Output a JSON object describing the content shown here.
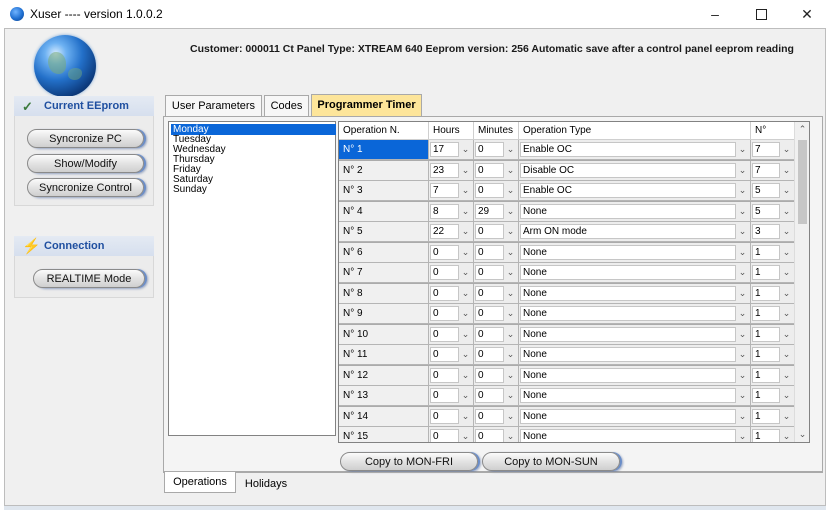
{
  "window": {
    "title": "Xuser ---- version 1.0.0.2"
  },
  "header": {
    "info": "Customer: 000011 Ct Panel Type: XTREAM 640 Eeprom version: 256  Automatic save after a control panel eeprom reading"
  },
  "sidebar": {
    "eeprom_title": "Current EEprom",
    "buttons": [
      "Syncronize PC",
      "Show/Modify",
      "Syncronize Control"
    ],
    "connection_title": "Connection",
    "realtime_label": "REALTIME Mode"
  },
  "tabs": [
    "User Parameters",
    "Codes",
    "Programmer Timer"
  ],
  "days": [
    "Monday",
    "Tuesday",
    "Wednesday",
    "Thursday",
    "Friday",
    "Saturday",
    "Sunday"
  ],
  "grid": {
    "headers": [
      "Operation N.",
      "Hours",
      "Minutes",
      "Operation Type",
      "N°"
    ],
    "rows": [
      {
        "op": "N° 1",
        "hours": "17",
        "minutes": "0",
        "type": "Enable OC",
        "n": "7"
      },
      {
        "op": "N° 2",
        "hours": "23",
        "minutes": "0",
        "type": "Disable OC",
        "n": "7"
      },
      {
        "op": "N° 3",
        "hours": "7",
        "minutes": "0",
        "type": "Enable OC",
        "n": "5"
      },
      {
        "op": "N° 4",
        "hours": "8",
        "minutes": "29",
        "type": "None",
        "n": "5"
      },
      {
        "op": "N° 5",
        "hours": "22",
        "minutes": "0",
        "type": "Arm ON mode",
        "n": "3"
      },
      {
        "op": "N° 6",
        "hours": "0",
        "minutes": "0",
        "type": "None",
        "n": "1"
      },
      {
        "op": "N° 7",
        "hours": "0",
        "minutes": "0",
        "type": "None",
        "n": "1"
      },
      {
        "op": "N° 8",
        "hours": "0",
        "minutes": "0",
        "type": "None",
        "n": "1"
      },
      {
        "op": "N° 9",
        "hours": "0",
        "minutes": "0",
        "type": "None",
        "n": "1"
      },
      {
        "op": "N° 10",
        "hours": "0",
        "minutes": "0",
        "type": "None",
        "n": "1"
      },
      {
        "op": "N° 11",
        "hours": "0",
        "minutes": "0",
        "type": "None",
        "n": "1"
      },
      {
        "op": "N° 12",
        "hours": "0",
        "minutes": "0",
        "type": "None",
        "n": "1"
      },
      {
        "op": "N° 13",
        "hours": "0",
        "minutes": "0",
        "type": "None",
        "n": "1"
      },
      {
        "op": "N° 14",
        "hours": "0",
        "minutes": "0",
        "type": "None",
        "n": "1"
      },
      {
        "op": "N° 15",
        "hours": "0",
        "minutes": "0",
        "type": "None",
        "n": "1"
      }
    ]
  },
  "actions": {
    "copy_mon_fri": "Copy to MON-FRI",
    "copy_mon_sun": "Copy to MON-SUN"
  },
  "bottom_tabs": [
    "Operations",
    "Holidays"
  ],
  "colors": {
    "accent_selected": "#0a66d8",
    "active_tab": "#fde59a",
    "sidebar_header_text": "#1f4fa0"
  }
}
